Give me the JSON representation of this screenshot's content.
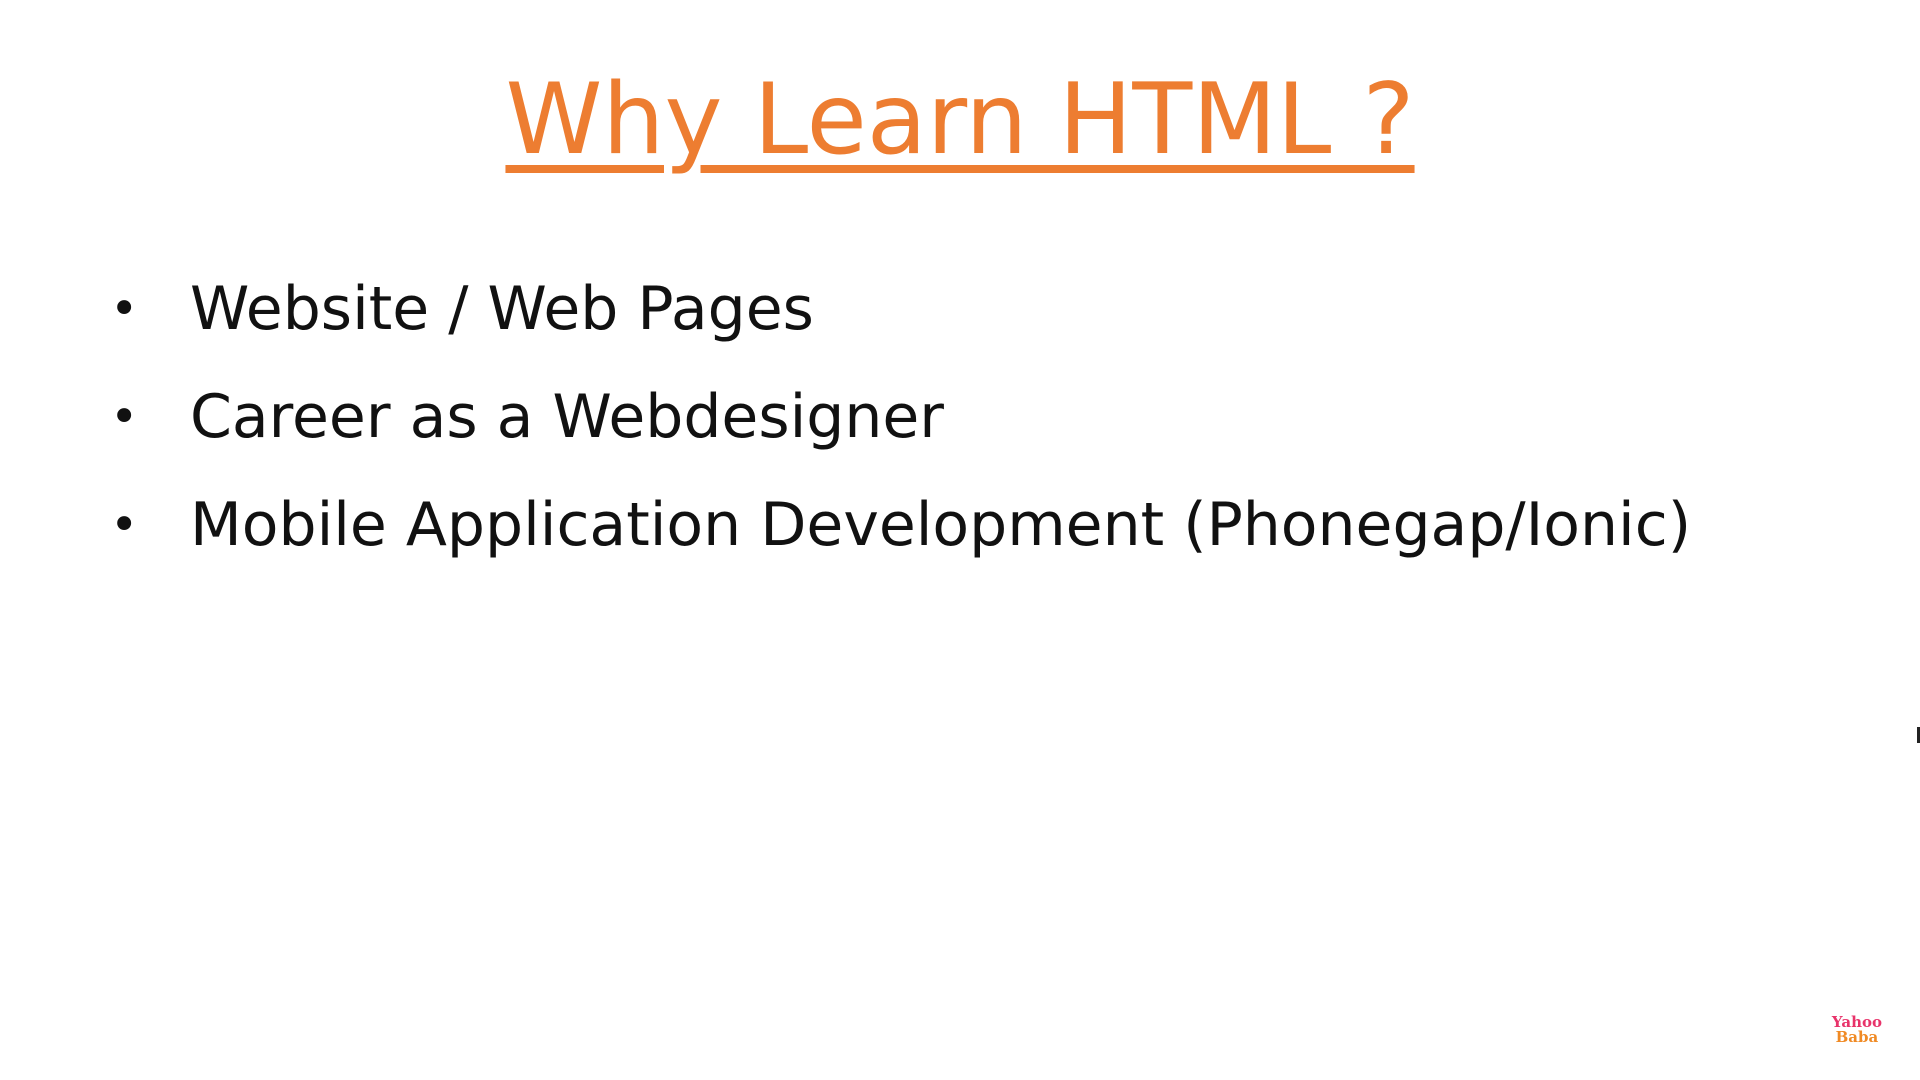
{
  "slide": {
    "title": "Why Learn HTML ?",
    "title_color": "#ED7D31",
    "bullet_glyph": "•",
    "bullets": [
      "Website / Web Pages",
      "Career as a Webdesigner",
      "Mobile Application Development (Phonegap/Ionic)"
    ]
  },
  "watermark": {
    "line1": "Yahoo",
    "line2": "Baba",
    "colors": [
      "#E8336A",
      "#F08A24"
    ]
  }
}
